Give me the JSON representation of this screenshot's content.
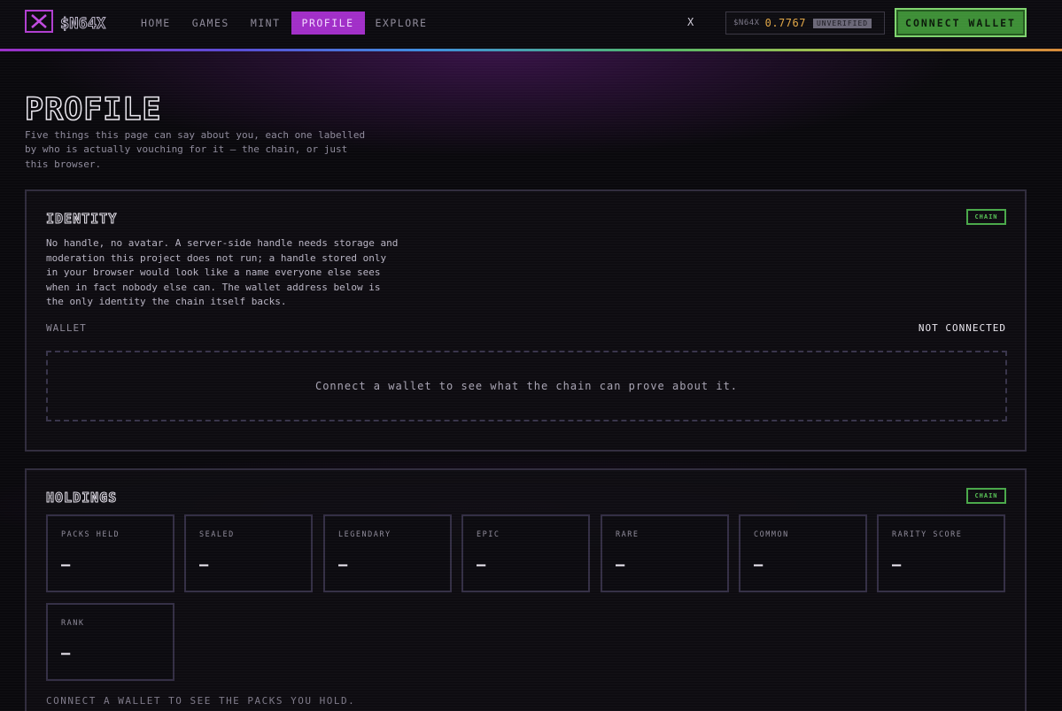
{
  "header": {
    "brand": "$N64X",
    "nav": [
      {
        "label": "HOME"
      },
      {
        "label": "GAMES"
      },
      {
        "label": "MINT"
      },
      {
        "label": "PROFILE",
        "active": true
      },
      {
        "label": "EXPLORE"
      }
    ],
    "x_link": "X",
    "ticker": {
      "symbol": "$N64X",
      "price": "0.7767",
      "badge": "UNVERIFIED"
    },
    "connect_label": "CONNECT WALLET"
  },
  "page": {
    "title": "PROFILE",
    "subtitle": "Five things this page can say about you, each one labelled by who is actually vouching for it — the chain, or just this browser."
  },
  "identity": {
    "title": "IDENTITY",
    "tag": "CHAIN",
    "description": "No handle, no avatar. A server-side handle needs storage and moderation this project does not run; a handle stored only in your browser would look like a name everyone else sees when in fact nobody else can. The wallet address below is the only identity the chain itself backs.",
    "wallet_label": "WALLET",
    "wallet_status": "NOT CONNECTED",
    "empty_message": "Connect a wallet to see what the chain can prove about it."
  },
  "holdings": {
    "title": "HOLDINGS",
    "tag": "CHAIN",
    "stats": [
      {
        "label": "PACKS HELD",
        "value": "—"
      },
      {
        "label": "SEALED",
        "value": "—"
      },
      {
        "label": "LEGENDARY",
        "value": "—"
      },
      {
        "label": "EPIC",
        "value": "—"
      },
      {
        "label": "RARE",
        "value": "—"
      },
      {
        "label": "COMMON",
        "value": "—"
      },
      {
        "label": "RARITY SCORE",
        "value": "—"
      },
      {
        "label": "RANK",
        "value": "—"
      }
    ],
    "footnote": "CONNECT A WALLET TO SEE THE PACKS YOU HOLD."
  },
  "colors": {
    "accent": "#a12fc8",
    "connect_green": "#3e8f37",
    "chain_green": "#4aa84a",
    "price_gold": "#e0a646"
  }
}
